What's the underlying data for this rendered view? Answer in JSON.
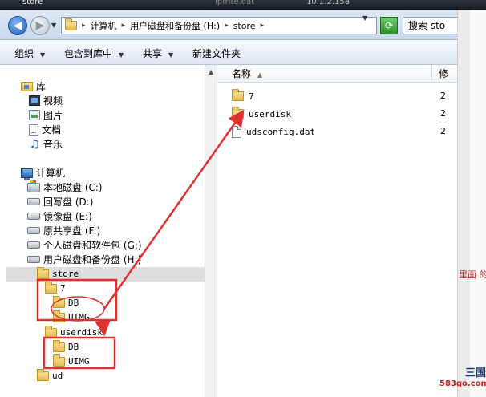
{
  "window": {
    "title": "store",
    "background_title": "ipfrite.dat",
    "ip": "10.1.2.158"
  },
  "address_bar": {
    "segments": [
      "计算机",
      "用户磁盘和备份盘 (H:)",
      "store"
    ],
    "search_placeholder": "搜索 sto"
  },
  "toolbar": {
    "organize": "组织",
    "include_in_library": "包含到库中",
    "share": "共享",
    "new_folder": "新建文件夹"
  },
  "nav": {
    "libraries": {
      "label": "库",
      "items": [
        "视频",
        "图片",
        "文档",
        "音乐"
      ]
    },
    "computer": {
      "label": "计算机",
      "drives": [
        "本地磁盘 (C:)",
        "回写盘 (D:)",
        "镜像盘 (E:)",
        "原共享盘 (F:)",
        "个人磁盘和软件包 (G:)",
        "用户磁盘和备份盘 (H:)"
      ]
    },
    "tree": {
      "store": "store",
      "seven": "7",
      "db1": "DB",
      "uimg1": "UIMG",
      "userdisk": "userdisk",
      "db2": "DB",
      "uimg2": "UIMG",
      "ud": "ud"
    }
  },
  "file_list": {
    "col_name": "名称",
    "col_second": "修",
    "items": [
      {
        "name": "7",
        "trunc": "2"
      },
      {
        "name": "userdisk",
        "trunc": "2"
      },
      {
        "name": "udsconfig.dat",
        "trunc": "2"
      }
    ]
  },
  "right_strip": {
    "fragment": "里面   的",
    "watermark_top": "三国",
    "watermark_bottom": "583go.com"
  },
  "annotations": {
    "color": "#e03030"
  }
}
